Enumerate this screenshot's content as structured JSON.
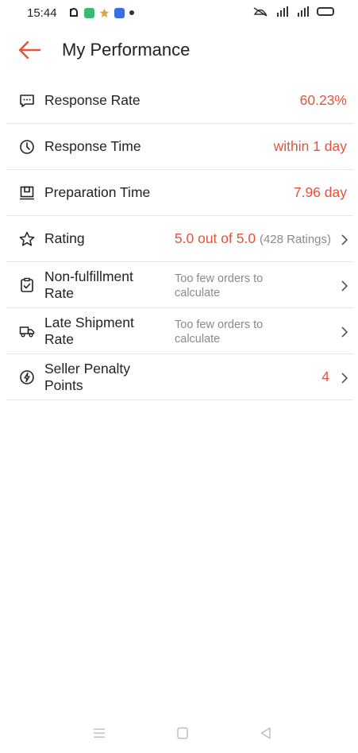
{
  "status_bar": {
    "time": "15:44",
    "right_text": "⁴⁶"
  },
  "header": {
    "title": "My Performance",
    "back_icon": "arrow-left-icon"
  },
  "colors": {
    "accent": "#e4533a",
    "muted": "#8a8a8a",
    "divider": "#e6e6e6"
  },
  "metrics": {
    "response_rate": {
      "label": "Response Rate",
      "value": "60.23%",
      "icon": "chat-bubble-icon"
    },
    "response_time": {
      "label": "Response Time",
      "value": "within 1 day",
      "icon": "clock-icon"
    },
    "preparation_time": {
      "label": "Preparation Time",
      "value": "7.96 day",
      "icon": "package-icon"
    },
    "rating": {
      "label": "Rating",
      "value": "5.0 out of 5.0",
      "count": "(428 Ratings)",
      "icon": "star-icon"
    },
    "non_fulfillment": {
      "label_line1": "Non-fulfillment",
      "label_line2": "Rate",
      "note_line1": "Too few orders to",
      "note_line2": "calculate",
      "icon": "clipboard-check-icon"
    },
    "late_shipment": {
      "label_line1": "Late Shipment",
      "label_line2": "Rate",
      "note_line1": "Too few orders to",
      "note_line2": "calculate",
      "icon": "truck-icon"
    },
    "penalty_points": {
      "label_line1": "Seller Penalty",
      "label_line2": "Points",
      "value": "4",
      "icon": "lightning-circle-icon"
    }
  },
  "nav_bar": {
    "buttons": [
      "menu-icon",
      "home-square-icon",
      "back-triangle-icon"
    ]
  }
}
